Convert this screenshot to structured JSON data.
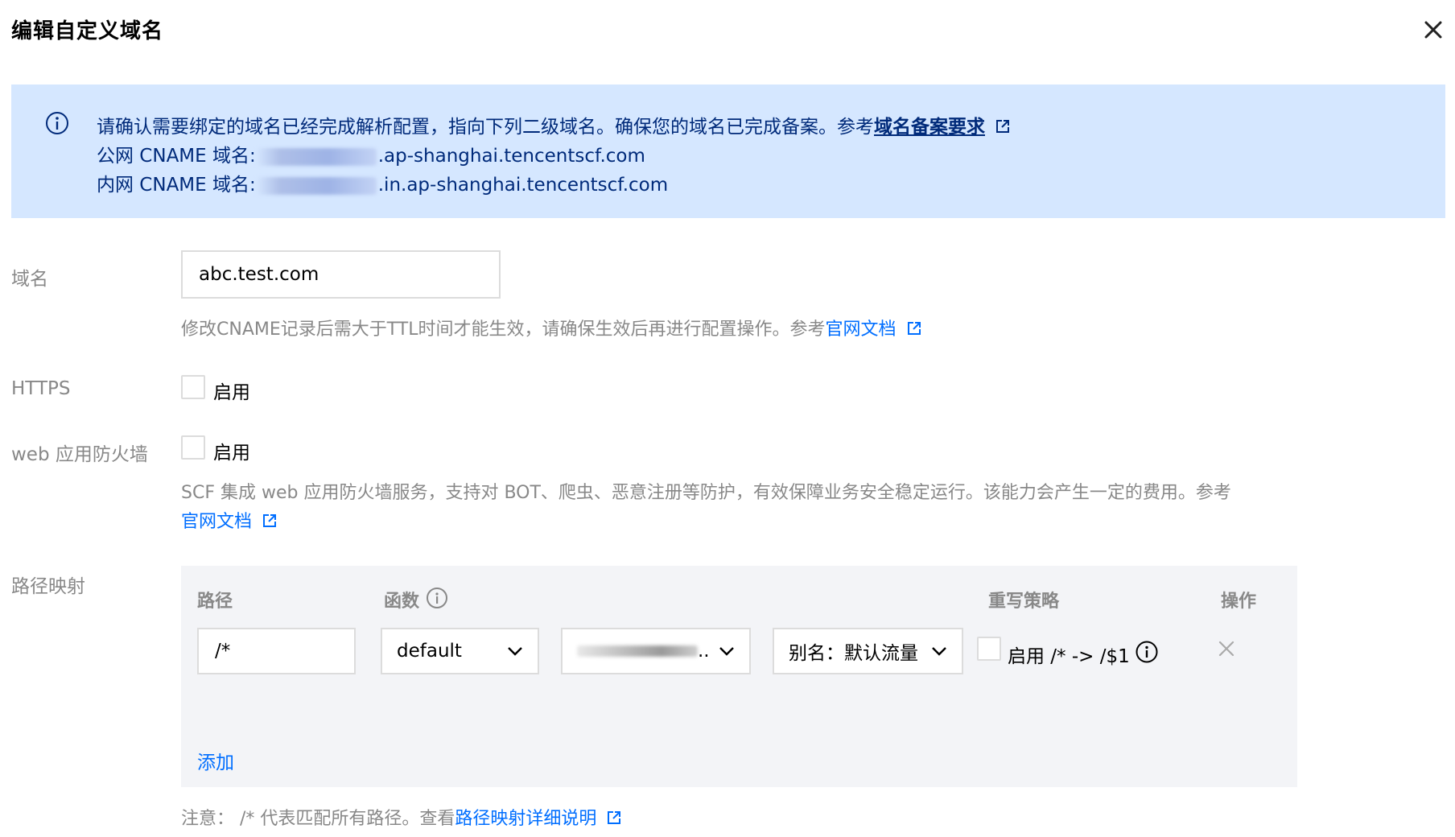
{
  "dialog": {
    "title": "编辑自定义域名",
    "close_icon": "close-icon"
  },
  "notice": {
    "line1_text": "请确认需要绑定的域名已经完成解析配置，指向下列二级域名。确保您的域名已完成备案。参考",
    "line1_link": "域名备案要求",
    "public_label": "公网 CNAME 域名:",
    "public_suffix": ".ap-shanghai.tencentscf.com",
    "private_label": "内网 CNAME 域名:",
    "private_suffix": ".in.ap-shanghai.tencentscf.com",
    "info_icon": "info-icon"
  },
  "domain": {
    "label": "域名",
    "value": "abc.test.com",
    "help_text": "修改CNAME记录后需大于TTL时间才能生效，请确保生效后再进行配置操作。参考",
    "help_link": "官网文档"
  },
  "https": {
    "label": "HTTPS",
    "checkbox_label": "启用"
  },
  "waf": {
    "label": "web 应用防火墙",
    "checkbox_label": "启用",
    "help_text": "SCF 集成 web 应用防火墙服务，支持对 BOT、爬虫、恶意注册等防护，有效保障业务安全稳定运行。该能力会产生一定的费用。参考",
    "help_link": "官网文档"
  },
  "path_mapping": {
    "label": "路径映射",
    "columns": {
      "path": "路径",
      "function": "函数",
      "rewrite": "重写策略",
      "action": "操作"
    },
    "row": {
      "path": "/*",
      "namespace": "default",
      "function_suffix": "..",
      "alias": "别名：默认流量",
      "rewrite_label": "启用 /* -> /$1"
    },
    "add_label": "添加",
    "note_text": "注意：  /* 代表匹配所有路径。查看",
    "note_link": "路径映射详细说明"
  },
  "colors": {
    "accent": "#006eff",
    "notice_bg": "#d5e7ff",
    "notice_text": "#002a7a",
    "muted": "#888888",
    "border": "#dcdcdc"
  }
}
